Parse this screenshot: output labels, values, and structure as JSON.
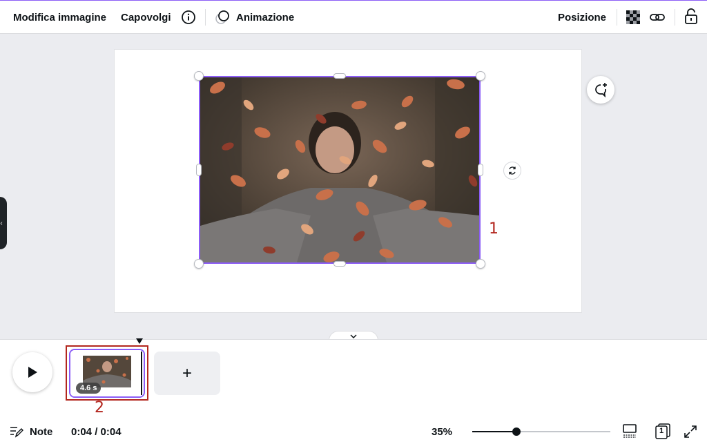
{
  "toolbar": {
    "edit_image": "Modifica immagine",
    "flip": "Capovolgi",
    "animate": "Animazione",
    "position": "Posizione"
  },
  "annotations": {
    "one": "1",
    "two": "2"
  },
  "timeline": {
    "scene_duration": "4.6 s",
    "add_scene": "+"
  },
  "bottombar": {
    "notes": "Note",
    "time": "0:04 / 0:04",
    "zoom": "35%",
    "zoom_level": 0.35,
    "page_count": "1"
  },
  "colors": {
    "accent": "#8b5cf6",
    "annotation": "#b3261e"
  }
}
